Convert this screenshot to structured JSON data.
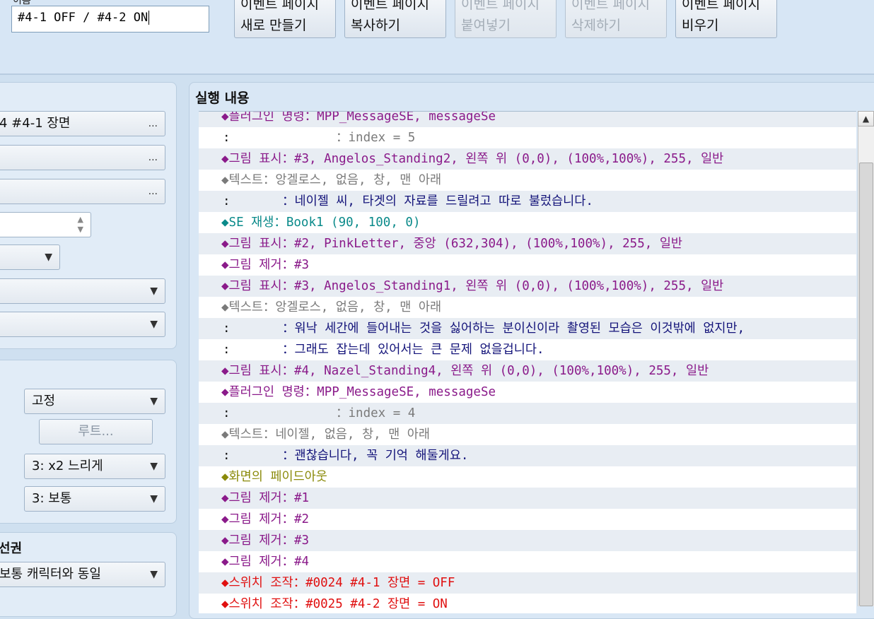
{
  "top": {
    "name_label": "이름",
    "name_value": "#4-1 OFF / #4-2 ON",
    "buttons": [
      {
        "line1": "이벤트 페이지",
        "line2": "새로 만들기",
        "enabled": true
      },
      {
        "line1": "이벤트 페이지",
        "line2": "복사하기",
        "enabled": true
      },
      {
        "line1": "이벤트 페이지",
        "line2": "붙여넣기",
        "enabled": false
      },
      {
        "line1": "이벤트 페이지",
        "line2": "삭제하기",
        "enabled": false
      },
      {
        "line1": "이벤트 페이지",
        "line2": "비우기",
        "enabled": true
      }
    ]
  },
  "conditions": {
    "switch1": "4 #4-1 장면",
    "ellipsis": "...",
    "spin_up": "▲",
    "spin_down": "▼",
    "dropdown_arrow": "▼"
  },
  "movement": {
    "type_value": "고정",
    "route_button": "루트...",
    "speed_value": "3: x2 느리게",
    "freq_value": "3: 보통"
  },
  "priority": {
    "title": "선권",
    "value": "보통 캐릭터와 동일"
  },
  "content": {
    "title": "실행 내용",
    "scroll_up": "▲",
    "rows": [
      {
        "gut": "",
        "text": "◆플러그인 명령：MPP_MessageSE, messageSe",
        "color": "c-purple",
        "indent": 32
      },
      {
        "gut": ":",
        "text": "：index = 5",
        "color": "c-gray",
        "indent": 194
      },
      {
        "gut": "",
        "text": "◆그림 표시：#3, Angelos_Standing2, 왼쪽 위 (0,0), (100%,100%), 255, 일반",
        "color": "c-purple",
        "indent": 32
      },
      {
        "gut": "",
        "text": "◆텍스트：앙겔로스, 없음, 창, 맨 아래",
        "color": "c-gray",
        "indent": 32
      },
      {
        "gut": ":",
        "text": "：네이젤 씨, 타겟의 자료를 드릴려고 따로 불렀습니다.",
        "color": "c-navy",
        "indent": 118
      },
      {
        "gut": "",
        "text": "◆SE 재생：Book1 (90, 100, 0)",
        "color": "c-teal",
        "indent": 32
      },
      {
        "gut": "",
        "text": "◆그림 표시：#2, PinkLetter, 중앙 (632,304), (100%,100%), 255, 일반",
        "color": "c-purple",
        "indent": 32
      },
      {
        "gut": "",
        "text": "◆그림 제거：#3",
        "color": "c-purple",
        "indent": 32
      },
      {
        "gut": "",
        "text": "◆그림 표시：#3, Angelos_Standing1, 왼쪽 위 (0,0), (100%,100%), 255, 일반",
        "color": "c-purple",
        "indent": 32
      },
      {
        "gut": "",
        "text": "◆텍스트：앙겔로스, 없음, 창, 맨 아래",
        "color": "c-gray",
        "indent": 32
      },
      {
        "gut": ":",
        "text": "：워낙 세간에 들어내는 것을 싫어하는 분이신이라 촬영된 모습은 이것밖에 없지만,",
        "color": "c-navy",
        "indent": 118
      },
      {
        "gut": ":",
        "text": "：그래도 잡는데 있어서는 큰 문제 없을겁니다.",
        "color": "c-navy",
        "indent": 118
      },
      {
        "gut": "",
        "text": "◆그림 표시：#4, Nazel_Standing4, 왼쪽 위 (0,0), (100%,100%), 255, 일반",
        "color": "c-purple",
        "indent": 32
      },
      {
        "gut": "",
        "text": "◆플러그인 명령：MPP_MessageSE, messageSe",
        "color": "c-purple",
        "indent": 32
      },
      {
        "gut": ":",
        "text": "：index = 4",
        "color": "c-gray",
        "indent": 194
      },
      {
        "gut": "",
        "text": "◆텍스트：네이젤, 없음, 창, 맨 아래",
        "color": "c-gray",
        "indent": 32
      },
      {
        "gut": ":",
        "text": "：괜찮습니다, 꼭 기억 해둘게요.",
        "color": "c-navy",
        "indent": 118
      },
      {
        "gut": "",
        "text": "◆화면의 페이드아웃",
        "color": "c-olive",
        "indent": 32
      },
      {
        "gut": "",
        "text": "◆그림 제거：#1",
        "color": "c-purple",
        "indent": 32
      },
      {
        "gut": "",
        "text": "◆그림 제거：#2",
        "color": "c-purple",
        "indent": 32
      },
      {
        "gut": "",
        "text": "◆그림 제거：#3",
        "color": "c-purple",
        "indent": 32
      },
      {
        "gut": "",
        "text": "◆그림 제거：#4",
        "color": "c-purple",
        "indent": 32
      },
      {
        "gut": "",
        "text": "◆스위치 조작：#0024 #4-1 장면 = OFF",
        "color": "c-red",
        "indent": 32
      },
      {
        "gut": "",
        "text": "◆스위치 조작：#0025 #4-2 장면 = ON",
        "color": "c-red",
        "indent": 32
      }
    ]
  },
  "colors": {
    "bg": "#cfe0f0",
    "purple": "#8a1a8a",
    "navy": "#14147a",
    "red": "#e01010"
  }
}
